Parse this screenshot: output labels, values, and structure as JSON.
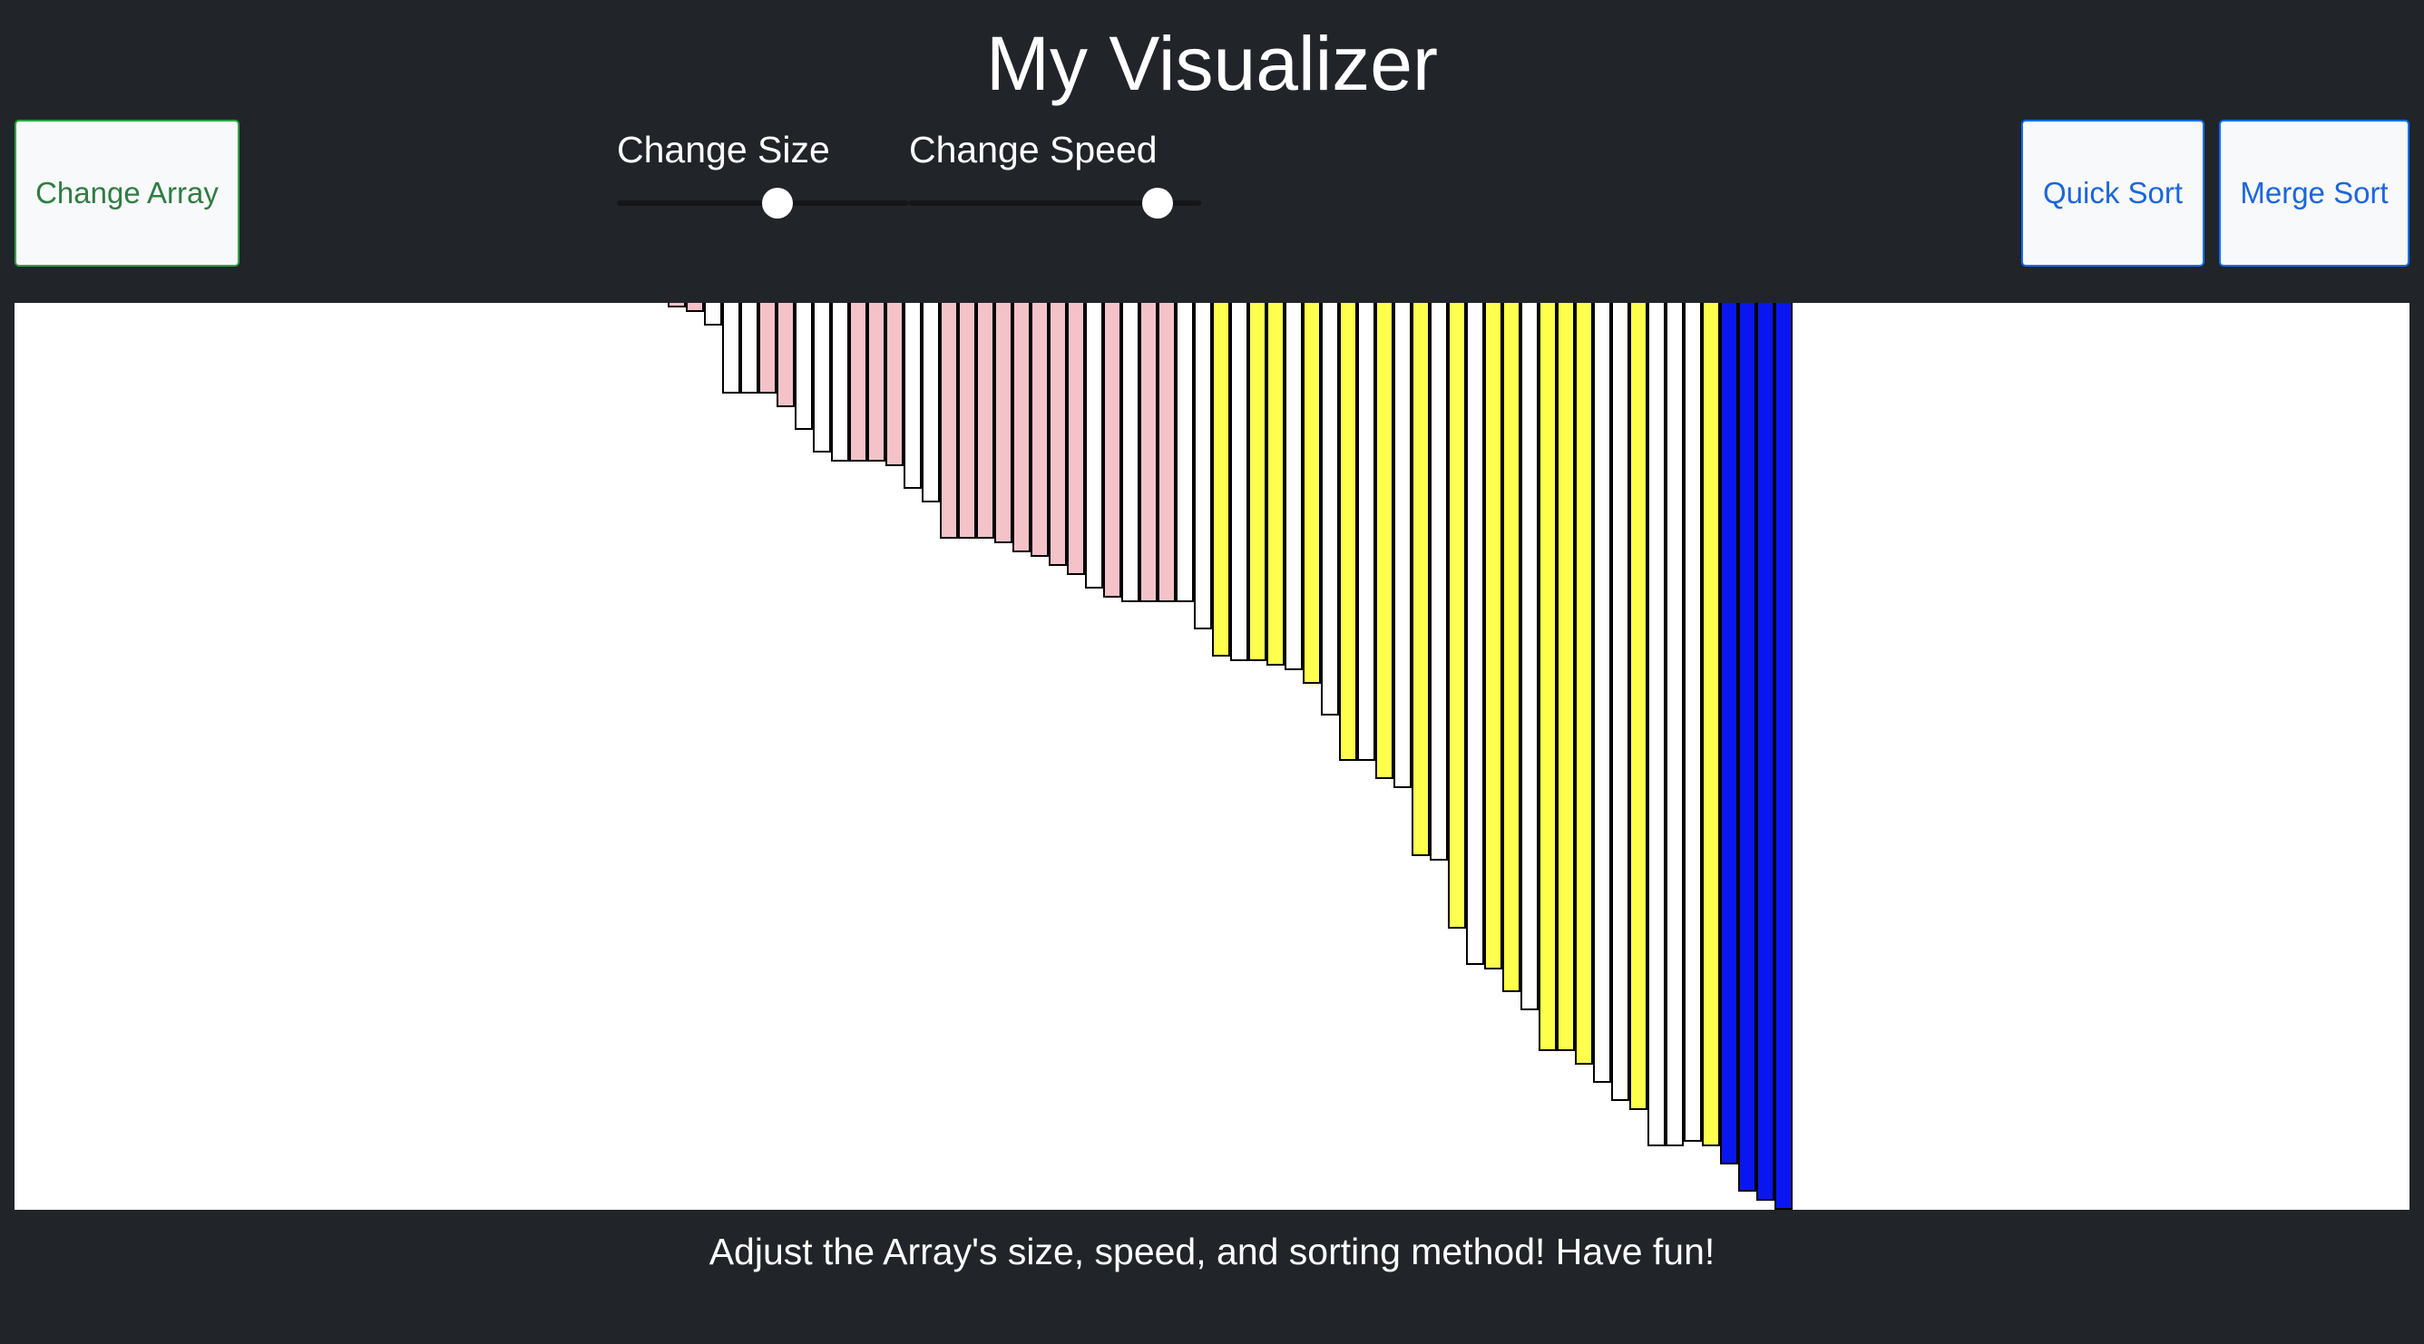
{
  "header": {
    "title": "My Visualizer"
  },
  "controls": {
    "change_array_label": "Change Array",
    "size_label": "Change Size",
    "speed_label": "Change Speed",
    "size_value": 0.55,
    "speed_value": 0.85,
    "quick_sort_label": "Quick Sort",
    "merge_sort_label": "Merge Sort"
  },
  "colors": {
    "background": "#212529",
    "unsorted": "#ffffff",
    "compare": "#f4c2c9",
    "pivot_range": "#ffff4d",
    "sorted": "#0a16f0"
  },
  "chart_data": {
    "type": "bar",
    "orientation": "hanging",
    "max_value": 1000,
    "values": [
      5,
      10,
      25,
      100,
      100,
      100,
      115,
      140,
      165,
      175,
      175,
      175,
      180,
      205,
      220,
      260,
      260,
      260,
      265,
      275,
      280,
      290,
      300,
      315,
      325,
      330,
      330,
      330,
      330,
      360,
      390,
      395,
      395,
      400,
      405,
      420,
      455,
      505,
      505,
      525,
      535,
      610,
      615,
      690,
      730,
      735,
      760,
      780,
      825,
      825,
      840,
      860,
      880,
      890,
      930,
      930,
      925,
      930,
      950,
      980,
      990,
      1000
    ],
    "states": [
      "compare",
      "compare",
      "unsorted",
      "unsorted",
      "unsorted",
      "compare",
      "compare",
      "unsorted",
      "unsorted",
      "unsorted",
      "compare",
      "compare",
      "compare",
      "unsorted",
      "unsorted",
      "compare",
      "compare",
      "compare",
      "compare",
      "compare",
      "compare",
      "compare",
      "compare",
      "unsorted",
      "compare",
      "unsorted",
      "compare",
      "compare",
      "unsorted",
      "unsorted",
      "pivot_range",
      "unsorted",
      "pivot_range",
      "pivot_range",
      "unsorted",
      "pivot_range",
      "unsorted",
      "pivot_range",
      "unsorted",
      "pivot_range",
      "unsorted",
      "pivot_range",
      "unsorted",
      "pivot_range",
      "unsorted",
      "pivot_range",
      "pivot_range",
      "unsorted",
      "pivot_range",
      "pivot_range",
      "pivot_range",
      "unsorted",
      "unsorted",
      "pivot_range",
      "unsorted",
      "unsorted",
      "unsorted",
      "pivot_range",
      "sorted",
      "sorted",
      "sorted",
      "sorted"
    ]
  },
  "footer": {
    "text": "Adjust the Array's size, speed, and sorting method! Have fun!"
  }
}
